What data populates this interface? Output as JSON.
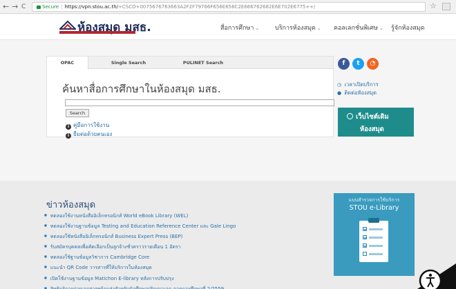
{
  "browser": {
    "back": "←",
    "forward": "→",
    "reload": "C",
    "secure_label": "Secure",
    "url_host": "https://vpn.stou.ac.th/",
    "url_path": "+CSCO+0075676763663A2F2F79766F656E656C2E666762682E6E702E6775++/",
    "bookmark_icon": "star-icon"
  },
  "header": {
    "logo_text": "ห้องสมุด มสธ.",
    "menu": [
      {
        "label": "สื่อการศึกษา",
        "has_dropdown": true
      },
      {
        "label": "บริการห้องสมุด",
        "has_dropdown": true
      },
      {
        "label": "คอลเลกชั่นพิเศษ",
        "has_dropdown": true
      },
      {
        "label": "รู้จักห้องสมุด",
        "has_dropdown": false
      }
    ],
    "chevron": "⌄"
  },
  "search": {
    "tabs": [
      {
        "label": "OPAC",
        "active": true
      },
      {
        "label": "Single Search",
        "active": false
      },
      {
        "label": "PULINET Search",
        "active": false
      }
    ],
    "title": "ค้นหาสื่อการศึกษาในห้องสมุด มสธ.",
    "input_value": "",
    "button": "Search",
    "links": [
      {
        "label": "คู่มือการใช้งาน",
        "icon": "info-icon"
      },
      {
        "label": "ยืมต่อด้วยตนเอง",
        "icon": "info-icon"
      }
    ]
  },
  "sidebar": {
    "social": [
      {
        "name": "facebook",
        "glyph": "f",
        "color": "#3b5998"
      },
      {
        "name": "twitter",
        "glyph": "t",
        "color": "#1da1f2"
      },
      {
        "name": "rss",
        "glyph": "◔",
        "color": "#f26522"
      }
    ],
    "links": [
      {
        "label": "เวลาเปิดบริการ",
        "glyph": "◷"
      },
      {
        "label": "ติดต่อห้องสมุด",
        "glyph": "●"
      }
    ],
    "old_site_line1": "เว็บไซต์เดิม",
    "old_site_line2": "ห้องสมุด"
  },
  "news": {
    "title": "ข่าวห้องสมุด",
    "items": [
      "ทดลองใช้งานหนังสืออิเล็กทรอนิกส์ World eBook Library (WEL)",
      "ทดลองใช้งานฐานข้อมูล Testing and Education Reference Center และ Gale Lingo",
      "ทดลองใช้หนังสืออิเล็กทรอนิกส์ Business Expert Press (BEP)",
      "รับสมัครบุคคลเพื่อคัดเลือกเป็นลูกจ้างชั่วคราวรายเดือน 1 อัตรา",
      "ทดลองใช้ฐานข้อมูลวิชาการ Cambridge Core",
      "แนะนำ QR Code วารสารที่ให้บริการในห้องสมุด",
      "เปิดใช้งานฐานข้อมูล Matichon E-library หลังการปรับปรุง",
      "สิทธิบริการถ่ายเอกสารพร้อมส่งสำหรับนักศึกษาปริญญาเอก ภาคการศึกษาที่ 2/2559"
    ]
  },
  "survey": {
    "line1": "แบบสำรวจการใช้บริการ",
    "line2": "STOU e-Library"
  },
  "accessibility_icon": "accessibility-icon",
  "colors": {
    "teal": "#1f8c8c",
    "survey_blue": "#3a9bbf",
    "link_blue": "#2a6fa8",
    "title_blue": "#2a4d7a",
    "logo_navy": "#1d2b5c",
    "secure_green": "#1a8f3d"
  }
}
